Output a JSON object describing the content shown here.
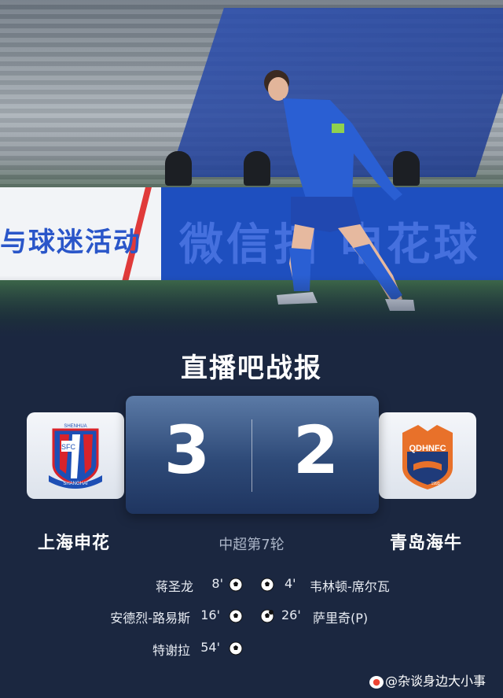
{
  "hero": {
    "hoarding_left_text": "与球迷活动",
    "hoarding_right_text": "微信扫 申花球"
  },
  "header": {
    "brand": "直播吧战报"
  },
  "match": {
    "home": {
      "name": "上海申花",
      "score": "3",
      "logo_text_top": "SHENHUA",
      "logo_text_bottom": "SHANGHAI",
      "logo_mark": "SFC"
    },
    "away": {
      "name": "青岛海牛",
      "score": "2",
      "logo_text": "QDHNFC",
      "logo_year": "1993"
    },
    "round": "中超第7轮"
  },
  "goals": {
    "home": [
      {
        "player": "蒋圣龙",
        "minute": "8'"
      },
      {
        "player": "安德烈-路易斯",
        "minute": "16'"
      },
      {
        "player": "特谢拉",
        "minute": "54'"
      }
    ],
    "away": [
      {
        "player": "韦林顿-席尔瓦",
        "minute": "4'"
      },
      {
        "player": "萨里奇(P)",
        "minute": "26'"
      }
    ]
  },
  "watermark": {
    "text": "@杂谈身边大小事",
    "icon": "weibo-icon"
  },
  "colors": {
    "background": "#1b2740",
    "score_panel": "#2e4a78",
    "home_red": "#d8232a",
    "home_blue": "#1d4fb5",
    "away_orange": "#e8712a"
  }
}
